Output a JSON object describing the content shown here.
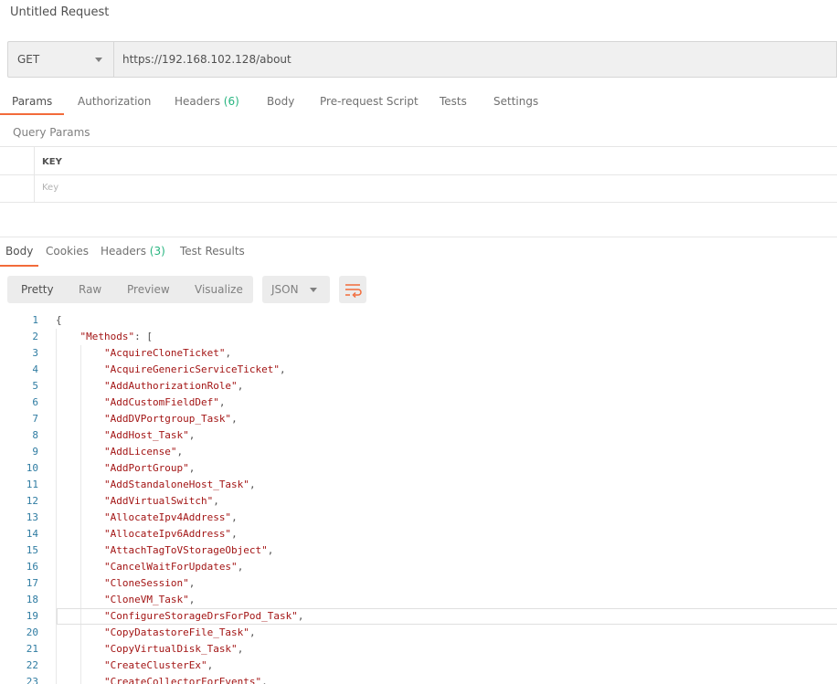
{
  "request": {
    "title": "Untitled Request",
    "method": "GET",
    "url": "https://192.168.102.128/about"
  },
  "request_tabs": [
    {
      "label": "Params",
      "count": ""
    },
    {
      "label": "Authorization",
      "count": ""
    },
    {
      "label": "Headers",
      "count": "(6)"
    },
    {
      "label": "Body",
      "count": ""
    },
    {
      "label": "Pre-request Script",
      "count": ""
    },
    {
      "label": "Tests",
      "count": ""
    },
    {
      "label": "Settings",
      "count": ""
    }
  ],
  "query_params": {
    "label": "Query Params",
    "column_key": "KEY",
    "key_placeholder": "Key"
  },
  "response_tabs": [
    {
      "label": "Body",
      "count": ""
    },
    {
      "label": "Cookies",
      "count": ""
    },
    {
      "label": "Headers",
      "count": "(3)"
    },
    {
      "label": "Test Results",
      "count": ""
    }
  ],
  "view_modes": [
    "Pretty",
    "Raw",
    "Preview",
    "Visualize"
  ],
  "format": "JSON",
  "icons": {
    "wrap": "wrap-lines-icon",
    "dropdown": "chevron-down-icon"
  },
  "colors": {
    "accent": "#f26b3a",
    "count": "#26b47f",
    "line_numbers": "#2f7ca2",
    "string": "#a31515"
  },
  "code_lines": [
    {
      "n": "1",
      "text": "{"
    },
    {
      "n": "2",
      "text": "    \"Methods\": ["
    },
    {
      "n": "3",
      "text": "        \"AcquireCloneTicket\","
    },
    {
      "n": "4",
      "text": "        \"AcquireGenericServiceTicket\","
    },
    {
      "n": "5",
      "text": "        \"AddAuthorizationRole\","
    },
    {
      "n": "6",
      "text": "        \"AddCustomFieldDef\","
    },
    {
      "n": "7",
      "text": "        \"AddDVPortgroup_Task\","
    },
    {
      "n": "8",
      "text": "        \"AddHost_Task\","
    },
    {
      "n": "9",
      "text": "        \"AddLicense\","
    },
    {
      "n": "10",
      "text": "        \"AddPortGroup\","
    },
    {
      "n": "11",
      "text": "        \"AddStandaloneHost_Task\","
    },
    {
      "n": "12",
      "text": "        \"AddVirtualSwitch\","
    },
    {
      "n": "13",
      "text": "        \"AllocateIpv4Address\","
    },
    {
      "n": "14",
      "text": "        \"AllocateIpv6Address\","
    },
    {
      "n": "15",
      "text": "        \"AttachTagToVStorageObject\","
    },
    {
      "n": "16",
      "text": "        \"CancelWaitForUpdates\","
    },
    {
      "n": "17",
      "text": "        \"CloneSession\","
    },
    {
      "n": "18",
      "text": "        \"CloneVM_Task\","
    },
    {
      "n": "19",
      "text": "        \"ConfigureStorageDrsForPod_Task\","
    },
    {
      "n": "20",
      "text": "        \"CopyDatastoreFile_Task\","
    },
    {
      "n": "21",
      "text": "        \"CopyVirtualDisk_Task\","
    },
    {
      "n": "22",
      "text": "        \"CreateClusterEx\","
    },
    {
      "n": "23",
      "text": "        \"CreateCollectorForEvents\","
    }
  ]
}
